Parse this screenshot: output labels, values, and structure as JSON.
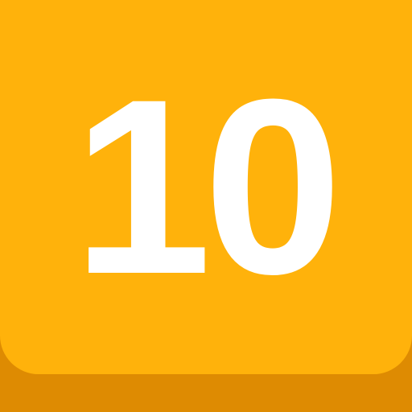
{
  "icon": {
    "number": "10",
    "face_color": "#FFB20B",
    "base_color": "#DE8B02",
    "text_color": "#FFFFFF"
  }
}
